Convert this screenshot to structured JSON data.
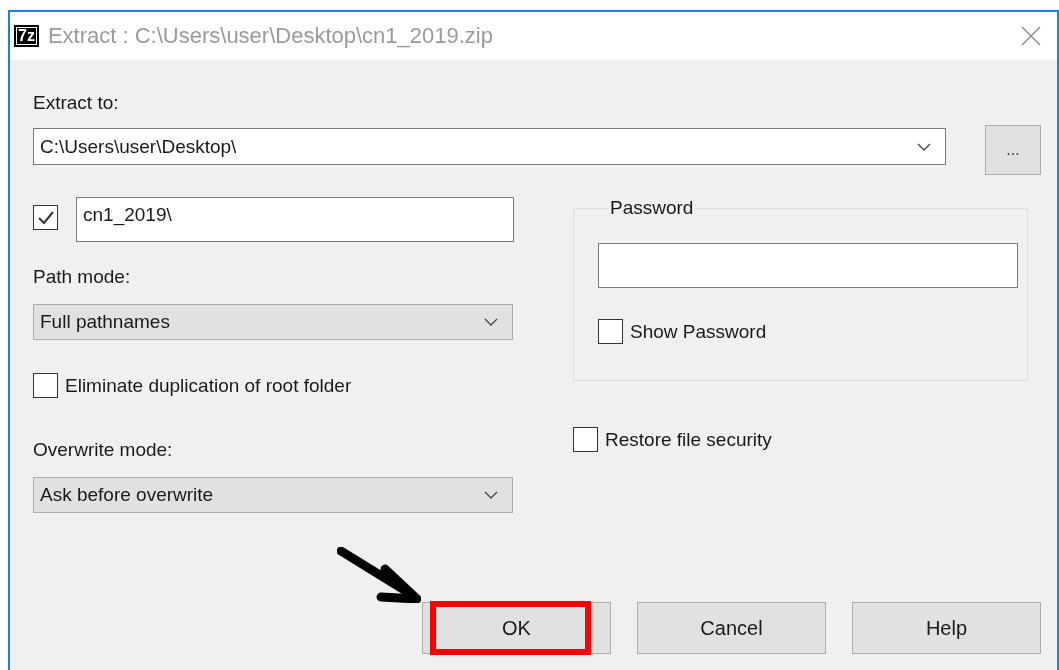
{
  "window": {
    "logo": "7z",
    "title": "Extract : C:\\Users\\user\\Desktop\\cn1_2019.zip"
  },
  "extract_to": {
    "label": "Extract to:",
    "value": "C:\\Users\\user\\Desktop\\",
    "browse": "..."
  },
  "folder": {
    "checked": true,
    "value": "cn1_2019\\"
  },
  "path_mode": {
    "label": "Path mode:",
    "value": "Full pathnames"
  },
  "eliminate_duplication": {
    "label": "Eliminate duplication of root folder",
    "checked": false
  },
  "overwrite_mode": {
    "label": "Overwrite mode:",
    "value": "Ask before overwrite"
  },
  "password": {
    "label": "Password",
    "show_password": {
      "label": "Show Password",
      "checked": false
    }
  },
  "restore_security": {
    "label": "Restore file security",
    "checked": false
  },
  "buttons": [
    {
      "label": "OK",
      "highlighted": true
    },
    {
      "label": "Cancel",
      "highlighted": false
    },
    {
      "label": "Help",
      "highlighted": false
    }
  ]
}
